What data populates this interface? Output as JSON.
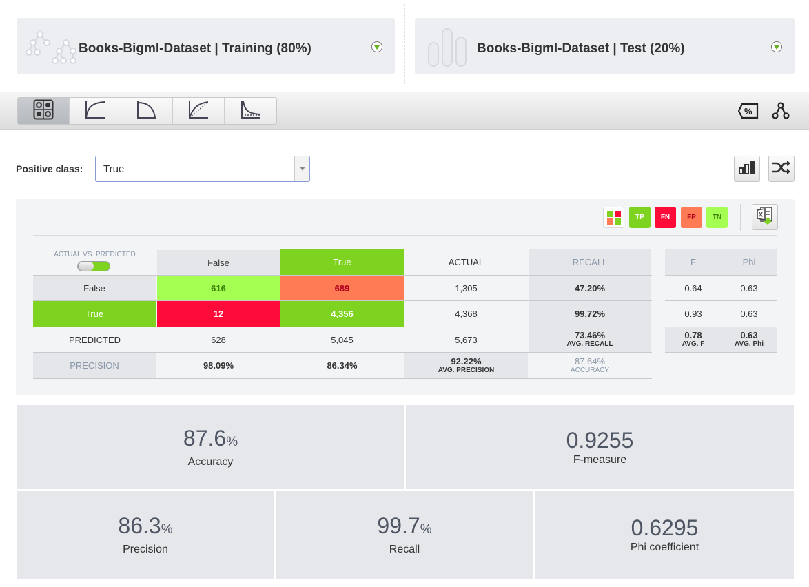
{
  "datasets": {
    "training": {
      "title": "Books-Bigml-Dataset | Training (80%)"
    },
    "test": {
      "title": "Books-Bigml-Dataset | Test (20%)"
    }
  },
  "toolbar": {
    "views": [
      "confusion-matrix-icon",
      "roc-curve-icon",
      "precision-recall-curve-icon",
      "gain-curve-icon",
      "lift-curve-icon"
    ],
    "right_icons": [
      "percent-tag-icon",
      "network-nodes-icon"
    ]
  },
  "positive_class": {
    "label": "Positive class:",
    "selected": "True"
  },
  "legend": {
    "tp": "TP",
    "fn": "FN",
    "fp": "FP",
    "tn": "TN",
    "colors": {
      "tp": "#7ed321",
      "fn": "#ff0b3a",
      "fp": "#ff7b56",
      "tn": "#a5ff52"
    }
  },
  "matrix": {
    "toggle_label": "ACTUAL VS. PREDICTED",
    "col_headers": [
      "False",
      "True"
    ],
    "actual_header": "ACTUAL",
    "recall_header": "RECALL",
    "rows": [
      {
        "label": "False",
        "cells": [
          "616",
          "689"
        ],
        "actual": "1,305",
        "recall": "47.20%"
      },
      {
        "label": "True",
        "cells": [
          "12",
          "4,356"
        ],
        "actual": "4,368",
        "recall": "99.72%"
      }
    ],
    "predicted": {
      "label": "PREDICTED",
      "cells": [
        "628",
        "5,045"
      ],
      "total": "5,673",
      "avg_recall": "73.46%",
      "avg_recall_label": "AVG. RECALL"
    },
    "precision": {
      "label": "PRECISION",
      "cells": [
        "98.09%",
        "86.34%"
      ],
      "avg_precision": "92.22%",
      "avg_precision_label": "AVG. PRECISION",
      "accuracy": "87.64%",
      "accuracy_label": "ACCURACY"
    }
  },
  "side_table": {
    "headers": [
      "F",
      "Phi"
    ],
    "rows": [
      [
        "0.64",
        "0.63"
      ],
      [
        "0.93",
        "0.63"
      ]
    ],
    "avg": {
      "f": "0.78",
      "f_label": "AVG. F",
      "phi": "0.63",
      "phi_label": "AVG. Phi"
    }
  },
  "metrics": {
    "accuracy": {
      "value": "87.6",
      "unit": "%",
      "label": "Accuracy"
    },
    "f_measure": {
      "value": "0.9255",
      "label": "F-measure"
    },
    "precision": {
      "value": "86.3",
      "unit": "%",
      "label": "Precision"
    },
    "recall": {
      "value": "99.7",
      "unit": "%",
      "label": "Recall"
    },
    "phi": {
      "value": "0.6295",
      "label": "Phi coefficient"
    }
  }
}
